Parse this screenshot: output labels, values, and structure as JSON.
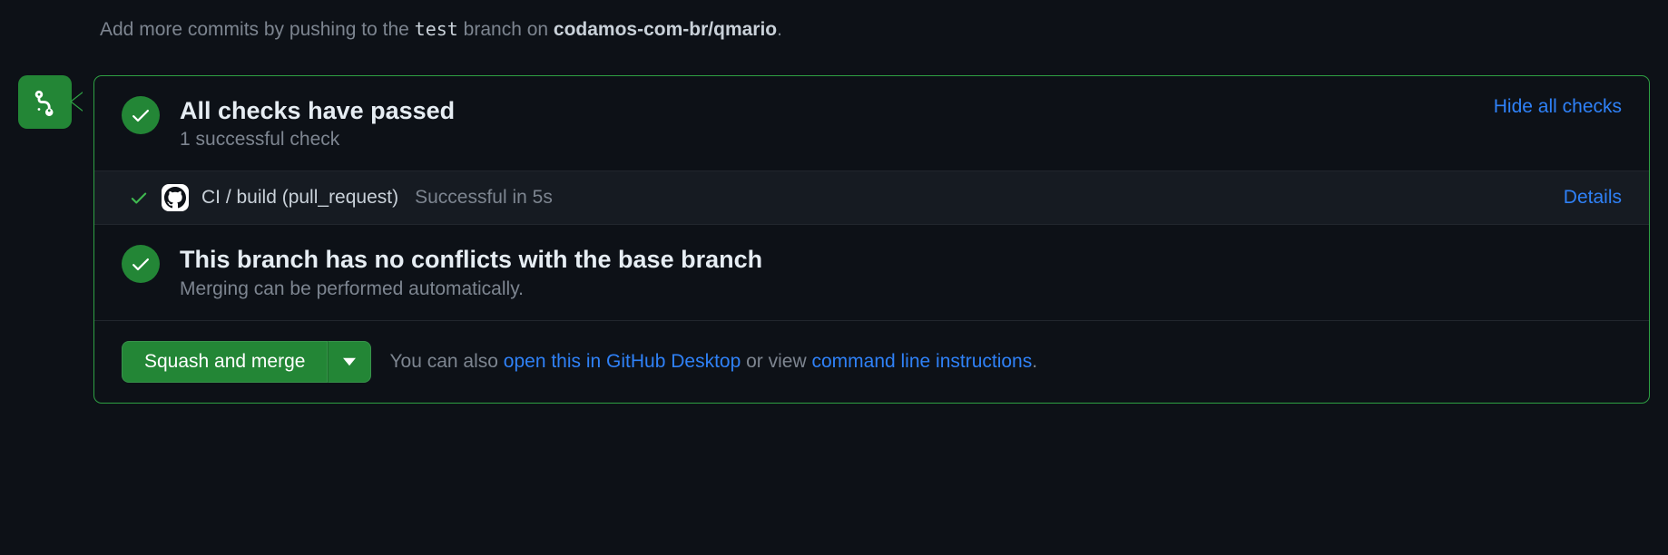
{
  "hint": {
    "prefix": "Add more commits by pushing to the ",
    "branch": "test",
    "middle": " branch on ",
    "repo": "codamos-com-br/qmario",
    "suffix": "."
  },
  "checks": {
    "title": "All checks have passed",
    "subtitle": "1 successful check",
    "toggle_label": "Hide all checks",
    "items": [
      {
        "name": "CI / build (pull_request)",
        "status": "Successful in 5s",
        "details_label": "Details"
      }
    ]
  },
  "conflicts": {
    "title": "This branch has no conflicts with the base branch",
    "subtitle": "Merging can be performed automatically."
  },
  "footer": {
    "merge_button": "Squash and merge",
    "text_prefix": "You can also ",
    "open_desktop": "open this in GitHub Desktop",
    "text_middle": " or view ",
    "cli_instructions": "command line instructions",
    "text_suffix": "."
  }
}
